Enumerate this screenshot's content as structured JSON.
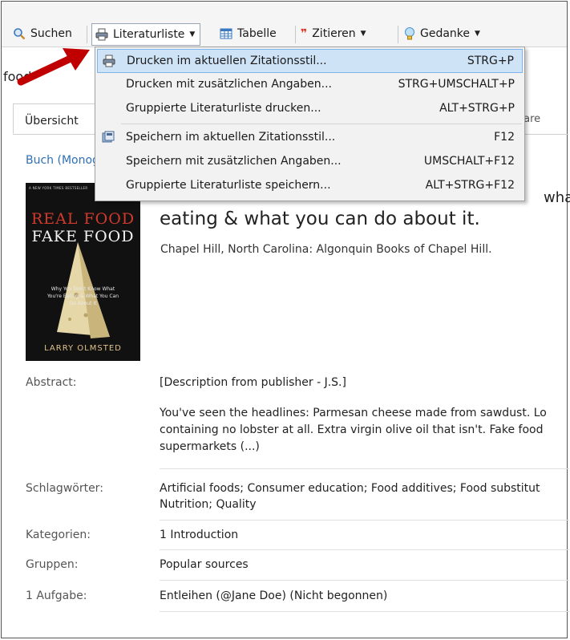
{
  "toolbar": {
    "search": "Suchen",
    "litlist": "Literaturliste",
    "table": "Tabelle",
    "cite": "Zitieren",
    "thought": "Gedanke"
  },
  "title_fragment": "food",
  "tabs": {
    "overview": "Übersicht",
    "right_fragment": "tare"
  },
  "record": {
    "type": "Buch (Monografie)",
    "title_line": "eating & what you can do about it.",
    "title_fragment": "wha",
    "publisher": "Chapel Hill, North Carolina: Algonquin Books of Chapel Hill.",
    "cover": {
      "nyt": "A NEW YORK TIMES BESTSELLER",
      "title_a": "REAL FOOD",
      "title_b": "FAKE FOOD",
      "subtitle": "Why You Don't Know What You're Eating & What You Can Do About It",
      "author": "LARRY OLMSTED"
    }
  },
  "fields": {
    "abstract_label": "Abstract:",
    "abstract_line1": "[Description from publisher - J.S.]",
    "abstract_body": "You've seen the headlines: Parmesan cheese made from sawdust. Lo\ncontaining no lobster at all. Extra virgin olive oil that isn't. Fake food\nsupermarkets (...)",
    "keywords_label": "Schlagwörter:",
    "keywords_line1": "Artificial foods; Consumer education; Food additives; Food substitut",
    "keywords_line2": "Nutrition; Quality",
    "categories_label": "Kategorien:",
    "categories_value": "1 Introduction",
    "groups_label": "Gruppen:",
    "groups_value": "Popular sources",
    "task_label": "1 Aufgabe:",
    "task_value": "Entleihen (@Jane Doe) (Nicht begonnen)"
  },
  "menu": {
    "items": [
      {
        "label": "Drucken im aktuellen Zitationsstil...",
        "shortcut": "STRG+P"
      },
      {
        "label": "Drucken mit zusätzlichen Angaben...",
        "shortcut": "STRG+UMSCHALT+P"
      },
      {
        "label": "Gruppierte Literaturliste drucken...",
        "shortcut": "ALT+STRG+P"
      },
      {
        "label": "Speichern im aktuellen Zitationsstil...",
        "shortcut": "F12"
      },
      {
        "label": "Speichern mit zusätzlichen Angaben...",
        "shortcut": "UMSCHALT+F12"
      },
      {
        "label": "Gruppierte Literaturliste speichern...",
        "shortcut": "ALT+STRG+F12"
      }
    ]
  },
  "colors": {
    "highlight": "#cfe3f7",
    "link": "#2f6fb3",
    "arrow": "#c00000"
  },
  "icons": [
    "search-icon",
    "printer-icon",
    "table-icon",
    "quote-icon",
    "lightbulb-icon",
    "save-icon",
    "caret-down-icon"
  ]
}
